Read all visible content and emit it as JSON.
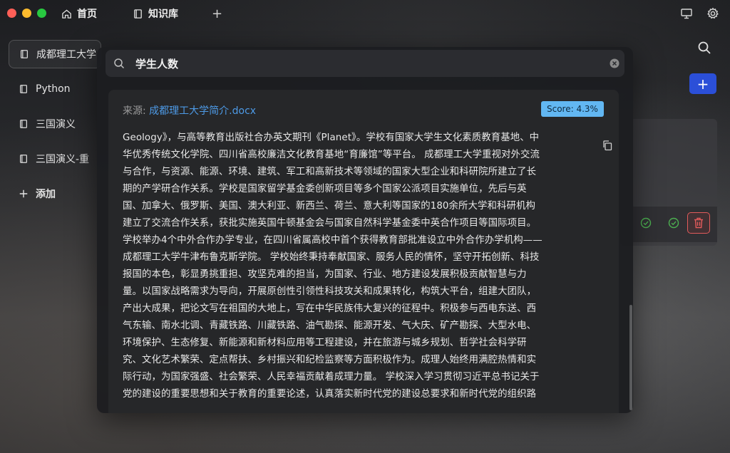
{
  "tabs": {
    "home_label": "首页",
    "kb_label": "知识库",
    "add_label": "+"
  },
  "sidebar": {
    "items": [
      {
        "label": "成都理工大学"
      },
      {
        "label": "Python"
      },
      {
        "label": "三国演义"
      },
      {
        "label": "三国演义-重"
      }
    ],
    "add_label": "添加"
  },
  "main": {
    "add_button_label": "+"
  },
  "search": {
    "query": "学生人数"
  },
  "result": {
    "source_prefix": "来源: ",
    "source_file": "成都理工大学简介.docx",
    "score": "Score: 4.3%",
    "lines": [
      "Geology》，与高等教育出版社合办英文期刊《Planet》。学校有国家大学生文化素质教育基地、中",
      "华优秀传统文化学院、四川省高校廉洁文化教育基地“育廉馆”等平台。 成都理工大学重视对外交流",
      "与合作，与资源、能源、环境、建筑、军工和高新技术等领域的国家大型企业和科研院所建立了长",
      "期的产学研合作关系。学校是国家留学基金委创新项目等多个国家公派项目实施单位，先后与英",
      "国、加拿大、俄罗斯、美国、澳大利亚、新西兰、荷兰、意大利等国家的180余所大学和科研机构",
      "建立了交流合作关系，获批实施英国牛顿基金会与国家自然科学基金委中英合作项目等国际项目。",
      "学校举办4个中外合作办学专业，在四川省属高校中首个获得教育部批准设立中外合作办学机构——",
      "成都理工大学牛津布鲁克斯学院。 学校始终秉持奉献国家、服务人民的情怀，坚守开拓创新、科技",
      "报国的本色，彰显勇挑重担、攻坚克难的担当，为国家、行业、地方建设发展积极贡献智慧与力",
      "量。以国家战略需求为导向，开展原创性引领性科技攻关和成果转化，构筑大平台，组建大团队，",
      "产出大成果，把论文写在祖国的大地上，写在中华民族伟大复兴的征程中。积极参与西电东送、西",
      "气东输、南水北调、青藏铁路、川藏铁路、油气勘探、能源开发、气大庆、矿产勘探、大型水电、",
      "环境保护、生态修复、新能源和新材料应用等工程建设，并在旅游与城乡规划、哲学社会科学研",
      "究、文化艺术繁荣、定点帮扶、乡村振兴和纪检监察等方面积极作为。成理人始终用满腔热情和实",
      "际行动，为国家强盛、社会繁荣、人民幸福贡献着成理力量。 学校深入学习贯彻习近平总书记关于",
      "党的建设的重要思想和关于教育的重要论述，认真落实新时代党的建设总要求和新时代党的组织路"
    ]
  },
  "colors": {
    "accent_blue": "#2b4fd8",
    "score_badge": "#62b7f2",
    "link": "#4d9ae6",
    "delete": "#e25b5b",
    "check": "#4caf50"
  }
}
